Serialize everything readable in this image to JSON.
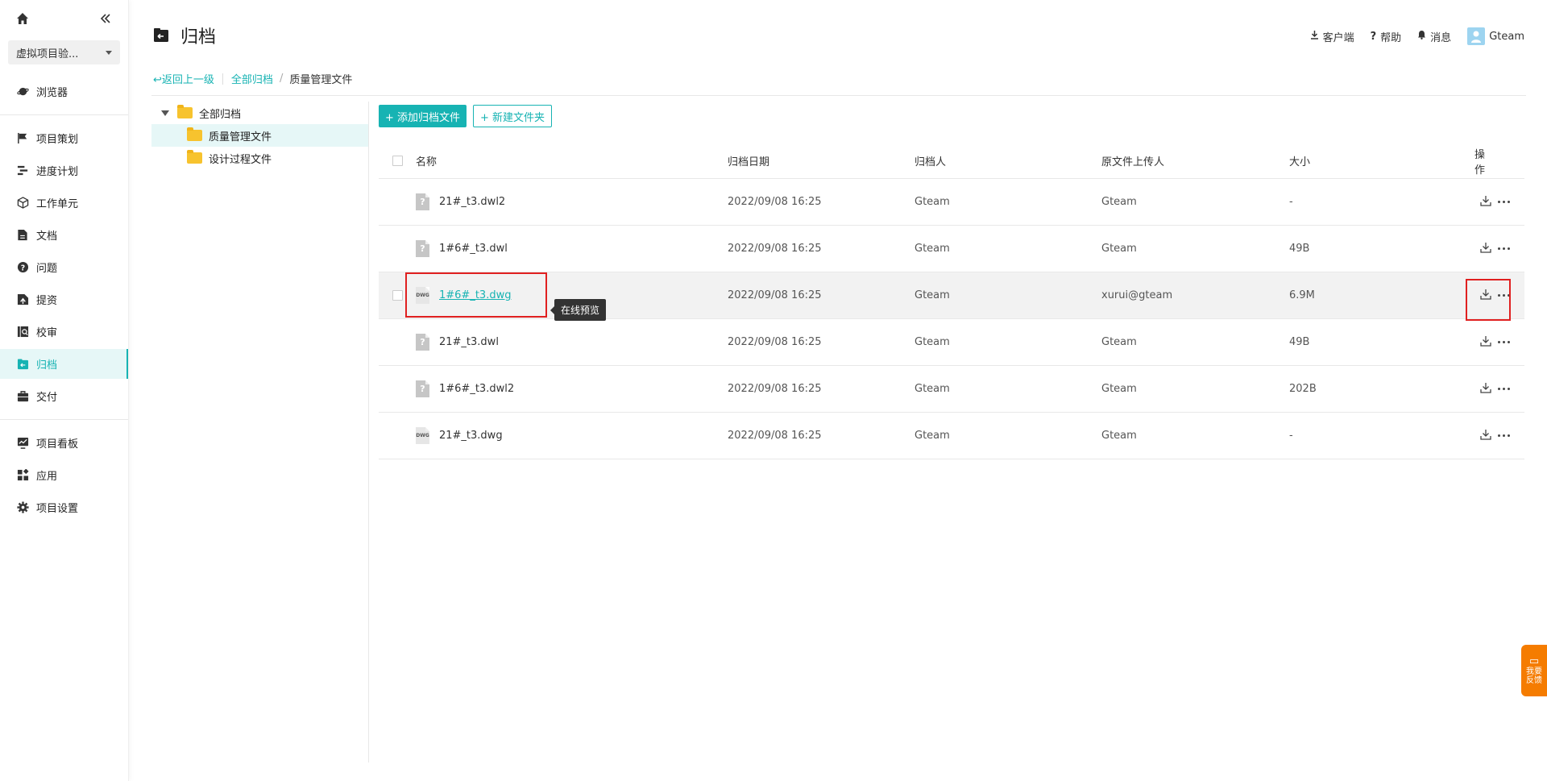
{
  "sidebar": {
    "project": "虚拟项目验...",
    "browser": "浏览器",
    "groups": [
      [
        {
          "label": "项目策划",
          "icon": "flag-icon"
        },
        {
          "label": "进度计划",
          "icon": "schedule-icon"
        },
        {
          "label": "工作单元",
          "icon": "cube-icon"
        },
        {
          "label": "文档",
          "icon": "document-icon"
        },
        {
          "label": "问题",
          "icon": "question-icon"
        },
        {
          "label": "提资",
          "icon": "submit-icon"
        },
        {
          "label": "校审",
          "icon": "review-icon"
        },
        {
          "label": "归档",
          "icon": "archive-icon",
          "active": true
        },
        {
          "label": "交付",
          "icon": "briefcase-icon"
        }
      ],
      [
        {
          "label": "项目看板",
          "icon": "dashboard-icon"
        },
        {
          "label": "应用",
          "icon": "apps-icon"
        },
        {
          "label": "项目设置",
          "icon": "gear-icon"
        }
      ]
    ]
  },
  "header": {
    "title": "归档",
    "client": "客户端",
    "help": "帮助",
    "messages": "消息",
    "user": "Gteam"
  },
  "breadcrumb": {
    "back": "返回上一级",
    "root": "全部归档",
    "sep": "/",
    "current": "质量管理文件"
  },
  "tree": {
    "root": "全部归档",
    "children": [
      "质量管理文件",
      "设计过程文件"
    ]
  },
  "toolbar": {
    "add_file": "+ 添加归档文件",
    "new_folder": "+ 新建文件夹"
  },
  "table": {
    "headers": {
      "name": "名称",
      "date": "归档日期",
      "archived_by": "归档人",
      "uploader": "原文件上传人",
      "size": "大小",
      "ops": "操作"
    },
    "rows": [
      {
        "name": "21#_t3.dwl2",
        "date": "2022/09/08 16:25",
        "archived_by": "Gteam",
        "uploader": "Gteam",
        "size": "-",
        "type": "unknown"
      },
      {
        "name": "1#6#_t3.dwl",
        "date": "2022/09/08 16:25",
        "archived_by": "Gteam",
        "uploader": "Gteam",
        "size": "49B",
        "type": "unknown"
      },
      {
        "name": "1#6#_t3.dwg",
        "date": "2022/09/08 16:25",
        "archived_by": "Gteam",
        "uploader": "xurui@gteam",
        "size": "6.9M",
        "type": "dwg"
      },
      {
        "name": "21#_t3.dwl",
        "date": "2022/09/08 16:25",
        "archived_by": "Gteam",
        "uploader": "Gteam",
        "size": "49B",
        "type": "unknown"
      },
      {
        "name": "1#6#_t3.dwl2",
        "date": "2022/09/08 16:25",
        "archived_by": "Gteam",
        "uploader": "Gteam",
        "size": "202B",
        "type": "unknown"
      },
      {
        "name": "21#_t3.dwg",
        "date": "2022/09/08 16:25",
        "archived_by": "Gteam",
        "uploader": "Gteam",
        "size": "-",
        "type": "dwg"
      }
    ],
    "tooltip": "在线预览",
    "dwg_label": "DWG",
    "unknown_label": "?"
  },
  "feedback": {
    "line1": "我要",
    "line2": "反馈"
  },
  "colors": {
    "accent": "#17b3b3",
    "highlight": "#e02020",
    "feedback": "#f57c00"
  }
}
